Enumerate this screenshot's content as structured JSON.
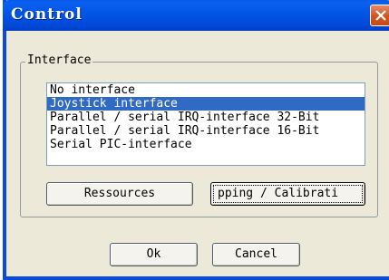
{
  "window": {
    "title": "Control",
    "close_icon": "close-icon"
  },
  "interface_group": {
    "label": "Interface",
    "items": [
      {
        "label": "No interface",
        "selected": false
      },
      {
        "label": "Joystick interface",
        "selected": true
      },
      {
        "label": "Parallel / serial IRQ-interface 32-Bit",
        "selected": false
      },
      {
        "label": "Parallel / serial IRQ-interface 16-Bit",
        "selected": false
      },
      {
        "label": "Serial PIC-interface",
        "selected": false
      }
    ],
    "ressources_label": "Ressources",
    "mapping_label": "pping / Calibrati"
  },
  "buttons": {
    "ok_label": "Ok",
    "cancel_label": "Cancel"
  },
  "colors": {
    "title_bar": "#0357e6",
    "selection": "#316ac5",
    "dialog_bg": "#ece9d8",
    "close_button": "#d3541f"
  }
}
